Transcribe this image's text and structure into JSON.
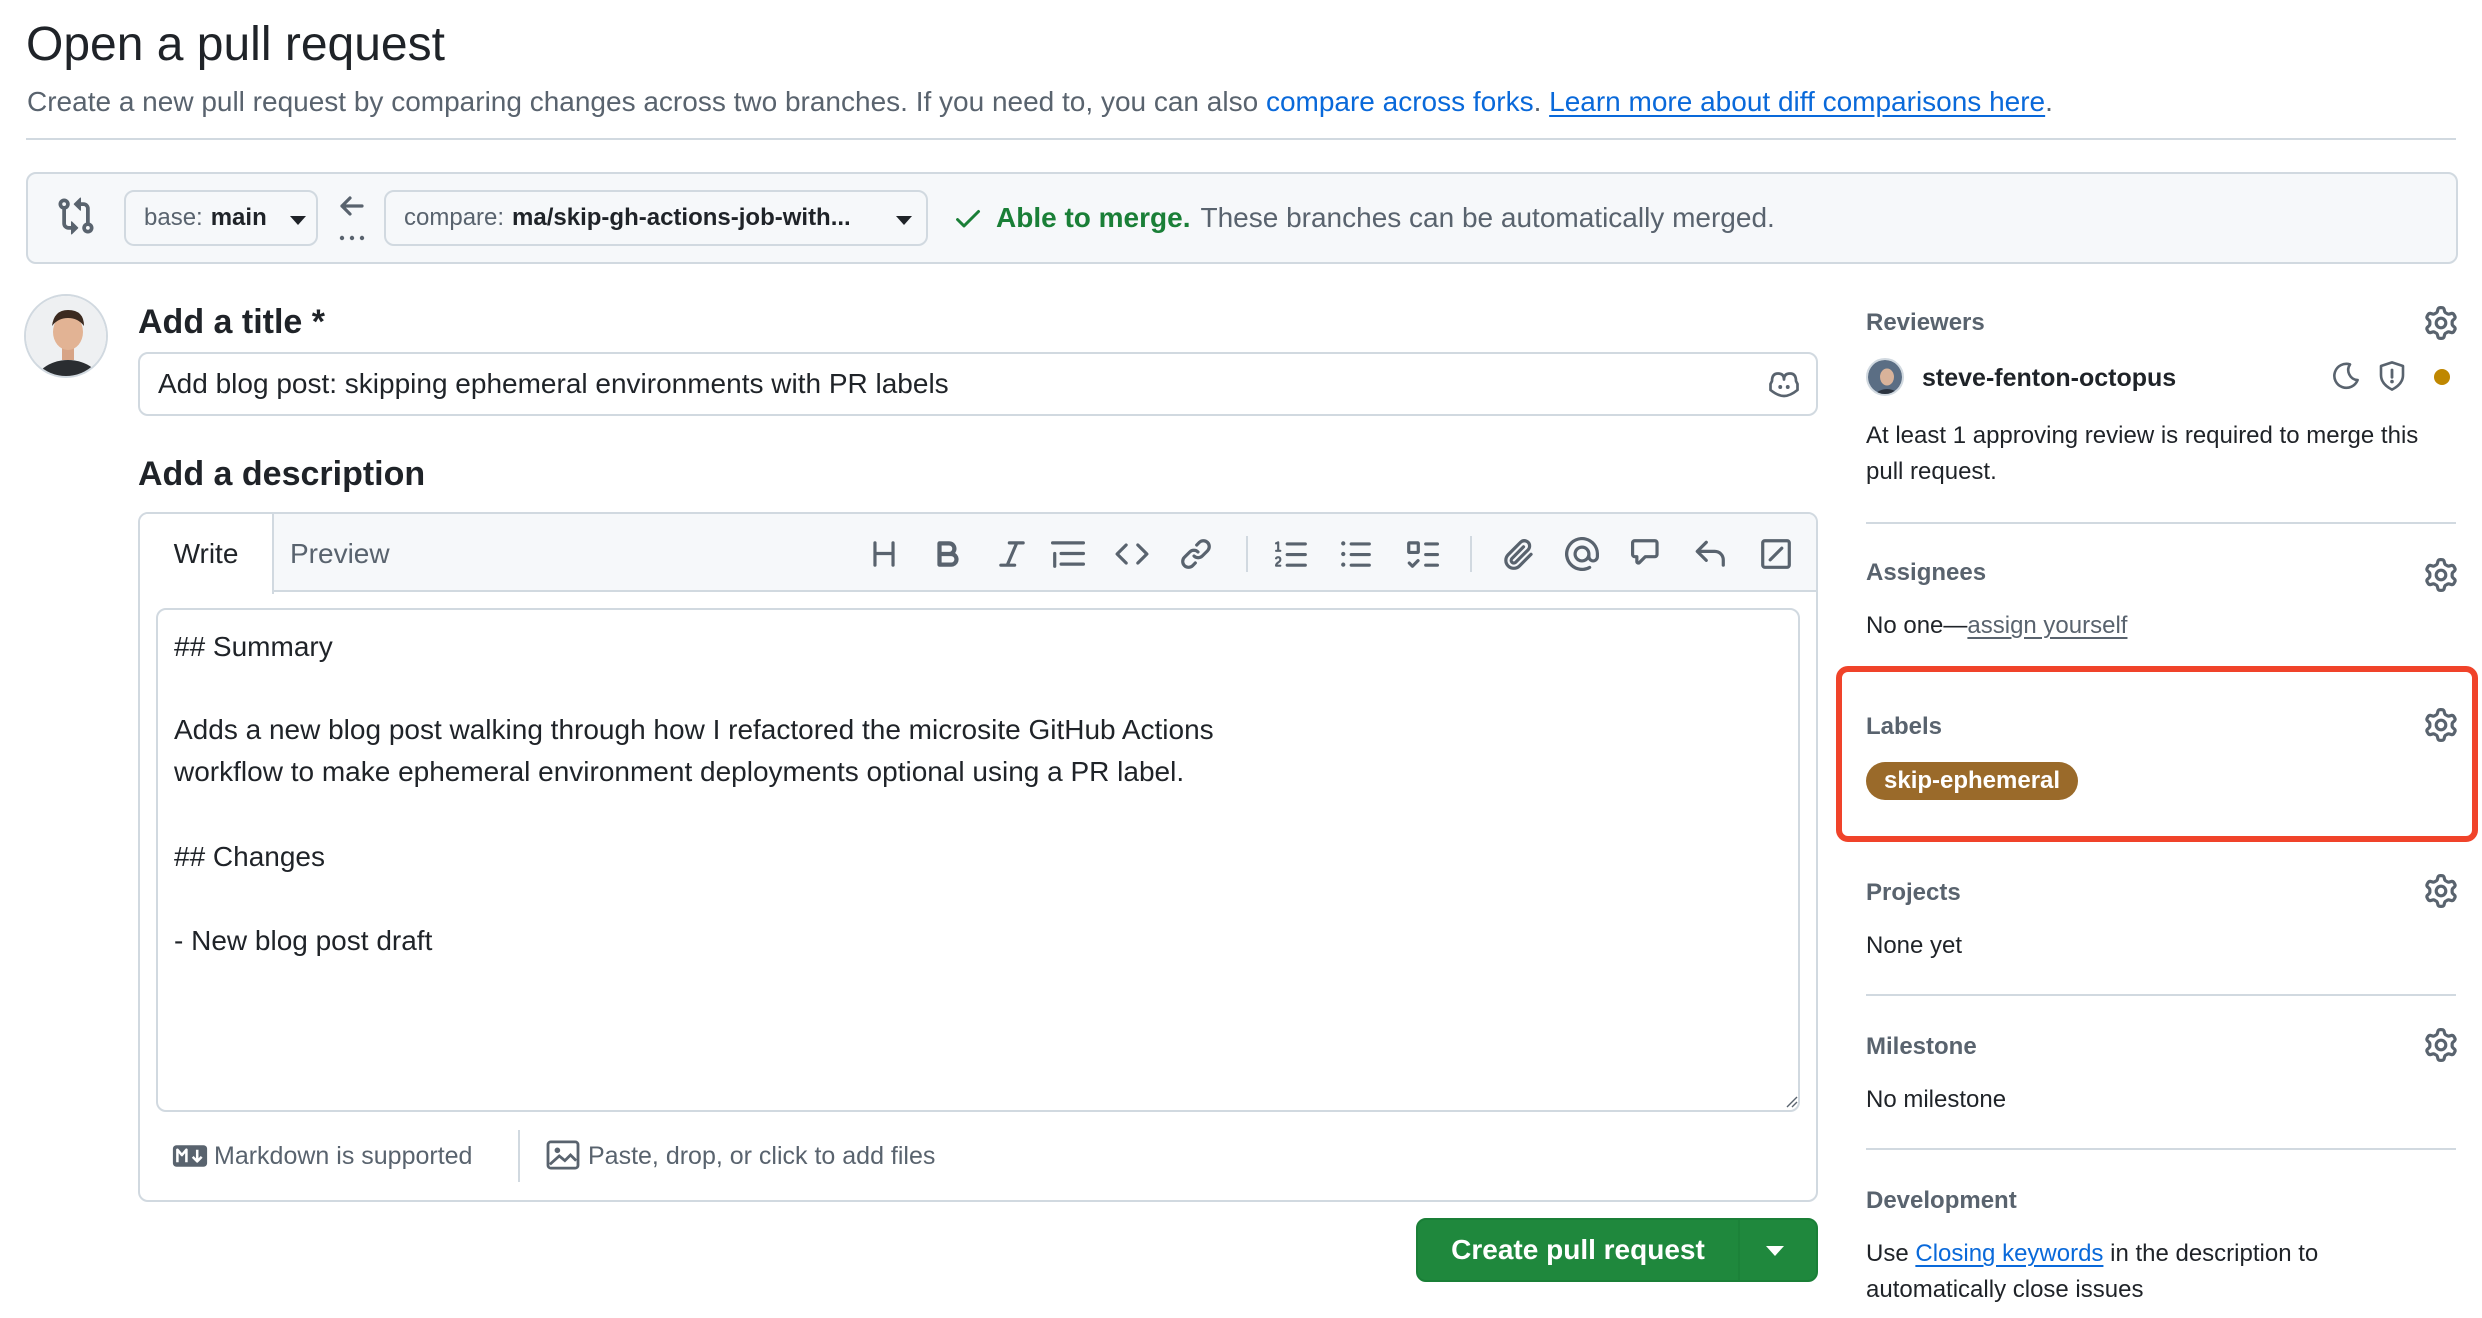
{
  "page": {
    "title": "Open a pull request",
    "subtitle_prefix": "Create a new pull request by comparing changes across two branches. If you need to, you can also ",
    "compare_forks_link": "compare across forks",
    "subtitle_mid": ". ",
    "learn_more_link": "Learn more about diff comparisons here",
    "subtitle_suffix": "."
  },
  "compare": {
    "base_prefix": "base:",
    "base_value": "main",
    "compare_prefix": "compare:",
    "compare_value": "ma/skip-gh-actions-job-with...",
    "merge_ok": "Able to merge.",
    "merge_detail": "These branches can be automatically merged."
  },
  "form": {
    "title_label": "Add a title *",
    "title_value": "Add blog post: skipping ephemeral environments with PR labels",
    "description_label": "Add a description",
    "tabs": {
      "write": "Write",
      "preview": "Preview"
    },
    "body_lines": [
      "## Summary",
      "",
      "Adds a new blog post walking through how I refactored the microsite GitHub Actions",
      "workflow to make ephemeral environment deployments optional using a PR label.",
      "",
      "## Changes",
      "",
      "- New blog post draft"
    ],
    "markdown_note": "Markdown is supported",
    "files_note": "Paste, drop, or click to add files",
    "submit_label": "Create pull request"
  },
  "sidebar": {
    "reviewers": {
      "heading": "Reviewers",
      "name": "steve-fenton-octopus",
      "note": "At least 1 approving review is required to merge this",
      "note_line2": "pull request."
    },
    "assignees": {
      "heading": "Assignees",
      "prefix": "No one—",
      "link": "assign yourself"
    },
    "labels": {
      "heading": "Labels",
      "chip": "skip-ephemeral",
      "chip_color": "#9a6a2a"
    },
    "projects": {
      "heading": "Projects",
      "value": "None yet"
    },
    "milestone": {
      "heading": "Milestone",
      "value": "No milestone"
    },
    "development": {
      "heading": "Development",
      "prefix": "Use ",
      "link": "Closing keywords",
      "suffix": " in the description to",
      "line2": "automatically close issues"
    }
  },
  "colors": {
    "accent": "#0969da",
    "success": "#1a7f37",
    "button": "#1f883d",
    "highlight": "#f0432a"
  }
}
